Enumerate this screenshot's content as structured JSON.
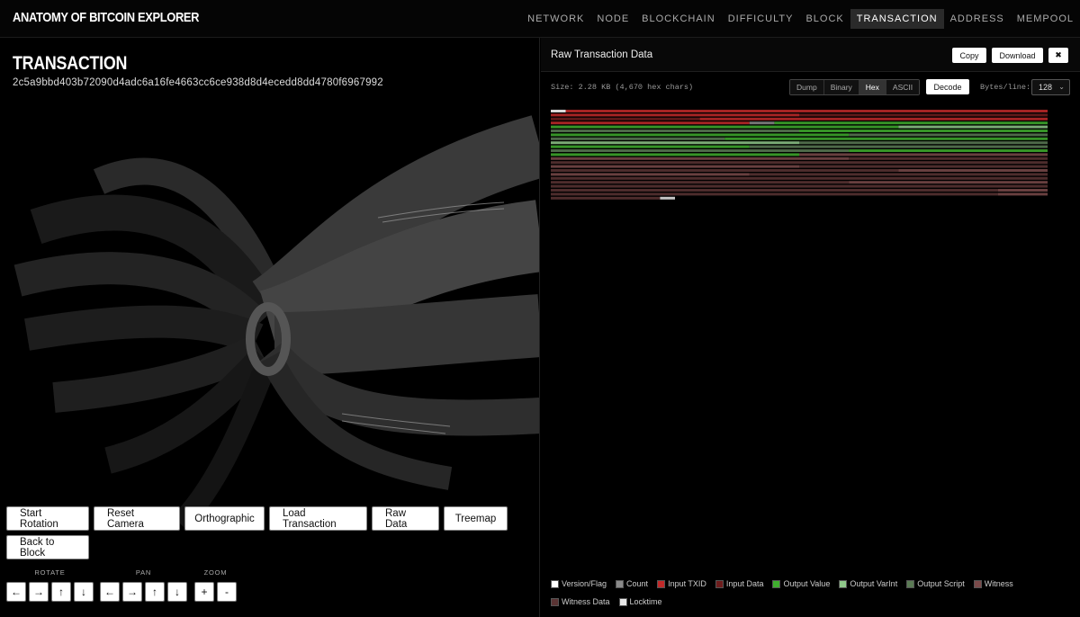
{
  "app": {
    "title": "ANATOMY OF BITCOIN EXPLORER"
  },
  "nav": [
    {
      "label": "NETWORK",
      "active": false
    },
    {
      "label": "NODE",
      "active": false
    },
    {
      "label": "BLOCKCHAIN",
      "active": false
    },
    {
      "label": "DIFFICULTY",
      "active": false
    },
    {
      "label": "BLOCK",
      "active": false
    },
    {
      "label": "TRANSACTION",
      "active": true
    },
    {
      "label": "ADDRESS",
      "active": false
    },
    {
      "label": "MEMPOOL",
      "active": false
    }
  ],
  "transaction": {
    "title": "TRANSACTION",
    "hash": "2c5a9bbd403b72090d4adc6a16fe4663cc6ce938d8d4ecedd8dd4780f6967992"
  },
  "buttons": {
    "start_rotation": "Start Rotation",
    "reset_camera": "Reset Camera",
    "orthographic": "Orthographic",
    "load_transaction": "Load Transaction",
    "raw_data": "Raw Data",
    "treemap": "Treemap",
    "back_to_block": "Back to Block"
  },
  "controls": {
    "rotate": {
      "label": "ROTATE",
      "buttons": [
        "←",
        "→",
        "↑",
        "↓"
      ]
    },
    "pan": {
      "label": "PAN",
      "buttons": [
        "←",
        "→",
        "↑",
        "↓"
      ]
    },
    "zoom": {
      "label": "ZOOM",
      "buttons": [
        "+",
        "-"
      ]
    }
  },
  "raw_panel": {
    "title": "Raw Transaction Data",
    "copy": "Copy",
    "download": "Download",
    "close": "✖",
    "size": "Size: 2.28 KB (4,670 hex chars)",
    "views": [
      {
        "label": "Dump",
        "active": false
      },
      {
        "label": "Binary",
        "active": false
      },
      {
        "label": "Hex",
        "active": true
      },
      {
        "label": "ASCII",
        "active": false
      }
    ],
    "decode": "Decode",
    "bytes_per_line_label": "Bytes/line:",
    "bytes_per_line": "128"
  },
  "legend": [
    {
      "label": "Version/Flag",
      "color": "#ffffff"
    },
    {
      "label": "Count",
      "color": "#8a8a8a"
    },
    {
      "label": "Input TXID",
      "color": "#c22a2a"
    },
    {
      "label": "Input Data",
      "color": "#6e1d1d"
    },
    {
      "label": "Output Value",
      "color": "#3fae2e"
    },
    {
      "label": "Output VarInt",
      "color": "#8fc88a"
    },
    {
      "label": "Output Script",
      "color": "#5b7b55"
    },
    {
      "label": "Witness",
      "color": "#7a4a4a"
    },
    {
      "label": "Witness Data",
      "color": "#5a3434"
    },
    {
      "label": "Locktime",
      "color": "#e8e8e8"
    }
  ]
}
